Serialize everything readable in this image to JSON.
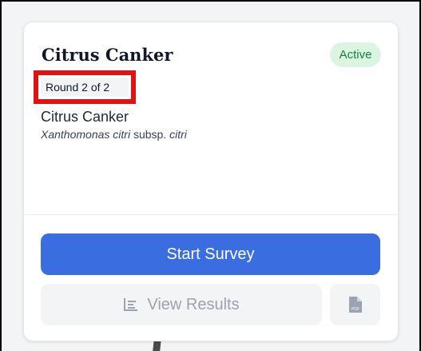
{
  "card": {
    "title": "Citrus Canker",
    "status": "Active",
    "round": "Round 2 of 2",
    "subject": {
      "common_name": "Citrus Canker",
      "genus_species": "Xanthomonas citri",
      "rank": "subsp.",
      "subspecies": "citri"
    },
    "actions": {
      "start_label": "Start Survey",
      "results_label": "View Results",
      "results_icon": "chart-list-icon",
      "pdf_icon": "pdf-file-icon"
    }
  },
  "colors": {
    "primary": "#3a6de0",
    "status_bg": "#dcf5e3",
    "status_text": "#15803d",
    "highlight": "#e11212"
  }
}
